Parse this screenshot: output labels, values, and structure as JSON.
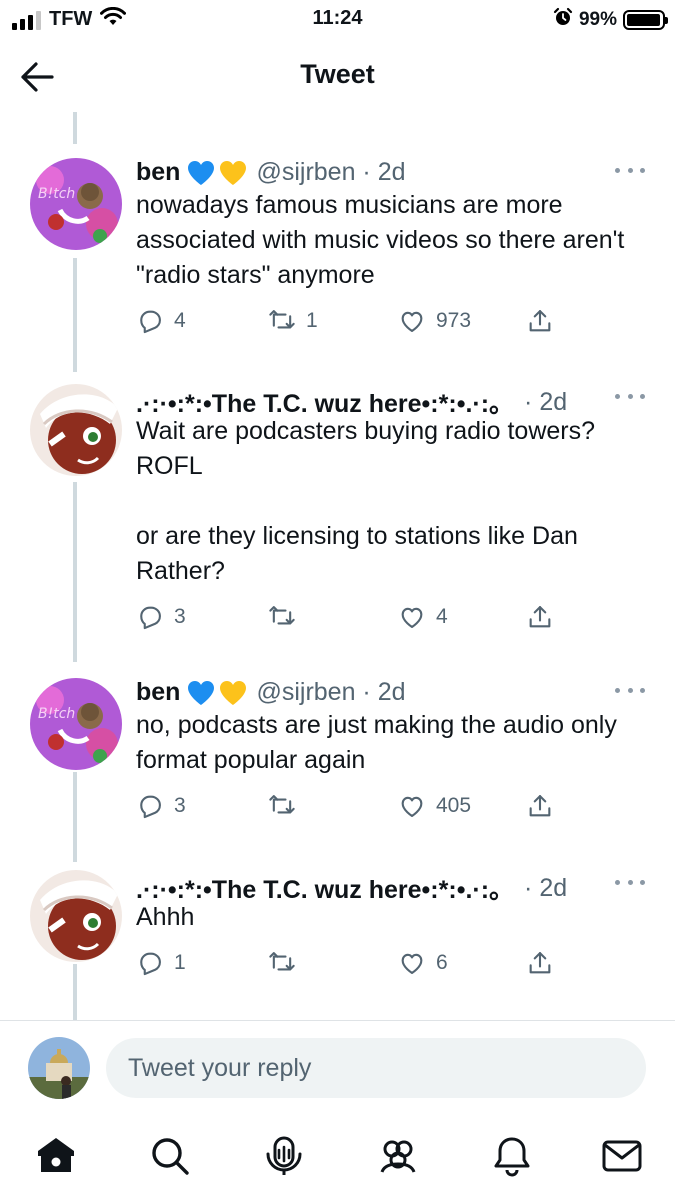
{
  "status_bar": {
    "carrier": "TFW",
    "time": "11:24",
    "battery_pct": "99%",
    "icons": [
      "signal-bars-icon",
      "wifi-icon",
      "alarm-clock-icon",
      "battery-icon"
    ]
  },
  "header": {
    "title": "Tweet",
    "back_icon": "arrow-left-icon"
  },
  "tweets": [
    {
      "name": "ben",
      "badges": [
        "💙",
        "💛"
      ],
      "handle_time": "@sijrben · 2d",
      "text": "nowadays famous musicians are more associated with music videos so there aren't \"radio stars\" anymore",
      "replies": "4",
      "retweets": "1",
      "likes": "973"
    },
    {
      "name": ".·:·•:*:•The T.C. wuz here•:*:•.·:。",
      "badges": [],
      "handle_time": "· 2d",
      "text": "Wait are podcasters buying radio towers? ROFL\n\nor are they licensing to stations like Dan Rather?",
      "replies": "3",
      "retweets": "",
      "likes": "4"
    },
    {
      "name": "ben",
      "badges": [
        "💙",
        "💛"
      ],
      "handle_time": "@sijrben · 2d",
      "text": "no, podcasts are just making the audio only format popular again",
      "replies": "3",
      "retweets": "",
      "likes": "405"
    },
    {
      "name": ".·:·•:*:•The T.C. wuz here•:*:•.·:。",
      "badges": [],
      "handle_time": "· 2d",
      "text": "Ahhh",
      "replies": "1",
      "retweets": "",
      "likes": "6"
    }
  ],
  "reply_bar": {
    "placeholder": "Tweet your reply"
  },
  "bottom_nav": {
    "items": [
      "home-icon",
      "search-icon",
      "spaces-icon",
      "communities-icon",
      "notifications-icon",
      "messages-icon"
    ]
  },
  "colors": {
    "text": "#0f1419",
    "secondary": "#536471",
    "thread_line": "#cfd9de",
    "input_bg": "#eff3f4"
  }
}
